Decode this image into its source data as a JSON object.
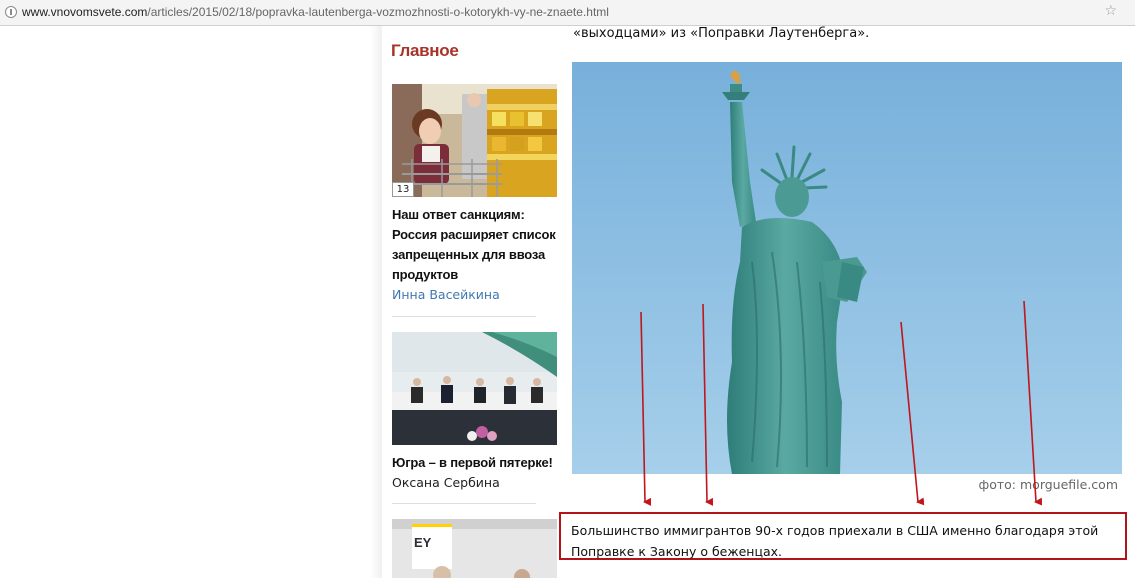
{
  "browser": {
    "url_domain": "www.vnovomsvete.com",
    "url_path": "/articles/2015/02/18/popravka-lautenberga-vozmozhnosti-o-kotorykh-vy-ne-znaete.html",
    "icons": {
      "site_info": "info-icon",
      "bookmark": "star-icon"
    }
  },
  "sidebar": {
    "title": "Главное",
    "cards": [
      {
        "comments": "13",
        "title": "Наш ответ санкциям: Россия расширяет список запрещенных для ввоза продуктов",
        "author": "Инна Васейкина"
      },
      {
        "title": "Югра – в первой пятерке!",
        "author": "Оксана Сербина"
      },
      {
        "logo_text": "EY"
      }
    ]
  },
  "article": {
    "top_text": "«выходцами» из «Поправки Лаутенберга».",
    "photo_credit": "фото: morguefile.com",
    "caption": "Большинство иммигрантов 90-х годов приехали в США именно благодаря этой Поправке к Закону о беженцах."
  },
  "colors": {
    "accent": "#a8332a",
    "highlight_border": "#b3141a",
    "author_link": "#4079b0",
    "sky": "#7fb6dc",
    "statue": "#4d9a94"
  }
}
